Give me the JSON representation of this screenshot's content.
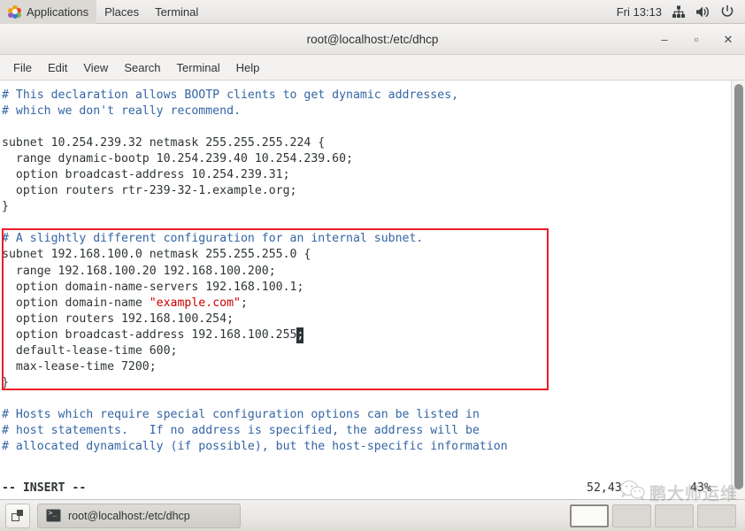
{
  "topbar": {
    "apps_label": "Applications",
    "places_label": "Places",
    "terminal_label": "Terminal",
    "clock": "Fri 13:13",
    "icons": {
      "applications": "pinwheel-icon",
      "network": "network-icon",
      "volume": "volume-icon",
      "power": "power-icon"
    }
  },
  "window": {
    "title": "root@localhost:/etc/dhcp",
    "buttons": {
      "minimize": "–",
      "maximize": "▫",
      "close": "✕"
    },
    "menu": [
      "File",
      "Edit",
      "View",
      "Search",
      "Terminal",
      "Help"
    ]
  },
  "terminal": {
    "lines": [
      {
        "segments": [
          {
            "text": "# This declaration allows BOOTP clients to get dynamic addresses,",
            "style": "comment"
          }
        ]
      },
      {
        "segments": [
          {
            "text": "# which we don't really recommend.",
            "style": "comment"
          }
        ]
      },
      {
        "segments": [
          {
            "text": "",
            "style": "plain"
          }
        ]
      },
      {
        "segments": [
          {
            "text": "subnet 10.254.239.32 netmask 255.255.255.224 {",
            "style": "plain"
          }
        ]
      },
      {
        "segments": [
          {
            "text": "  range dynamic-bootp 10.254.239.40 10.254.239.60;",
            "style": "plain"
          }
        ]
      },
      {
        "segments": [
          {
            "text": "  option broadcast-address 10.254.239.31;",
            "style": "plain"
          }
        ]
      },
      {
        "segments": [
          {
            "text": "  option routers rtr-239-32-1.example.org;",
            "style": "plain"
          }
        ]
      },
      {
        "segments": [
          {
            "text": "}",
            "style": "plain"
          }
        ]
      },
      {
        "segments": [
          {
            "text": "",
            "style": "plain"
          }
        ]
      },
      {
        "segments": [
          {
            "text": "# A slightly different configuration for an internal subnet.",
            "style": "comment"
          }
        ]
      },
      {
        "segments": [
          {
            "text": "subnet 192.168.100.0 netmask 255.255.255.0 {",
            "style": "plain"
          }
        ]
      },
      {
        "segments": [
          {
            "text": "  range 192.168.100.20 192.168.100.200;",
            "style": "plain"
          }
        ]
      },
      {
        "segments": [
          {
            "text": "  option domain-name-servers 192.168.100.1;",
            "style": "plain"
          }
        ]
      },
      {
        "segments": [
          {
            "text": "  option domain-name ",
            "style": "plain"
          },
          {
            "text": "\"example.com\"",
            "style": "string"
          },
          {
            "text": ";",
            "style": "plain"
          }
        ]
      },
      {
        "segments": [
          {
            "text": "  option routers 192.168.100.254;",
            "style": "plain"
          }
        ]
      },
      {
        "segments": [
          {
            "text": "  option broadcast-address 192.168.100.255",
            "style": "plain"
          },
          {
            "text": ";",
            "style": "cursor"
          }
        ]
      },
      {
        "segments": [
          {
            "text": "  default-lease-time 600;",
            "style": "plain"
          }
        ]
      },
      {
        "segments": [
          {
            "text": "  max-lease-time 7200;",
            "style": "plain"
          }
        ]
      },
      {
        "segments": [
          {
            "text": "}",
            "style": "plain"
          }
        ]
      },
      {
        "segments": [
          {
            "text": "",
            "style": "plain"
          }
        ]
      },
      {
        "segments": [
          {
            "text": "# Hosts which require special configuration options can be listed in",
            "style": "comment"
          }
        ]
      },
      {
        "segments": [
          {
            "text": "# host statements.   If no address is specified, the address will be",
            "style": "comment"
          }
        ]
      },
      {
        "segments": [
          {
            "text": "# allocated dynamically (if possible), but the host-specific information",
            "style": "comment"
          }
        ]
      }
    ],
    "status": {
      "mode": "-- INSERT --",
      "position": "52,43",
      "percent": "43%"
    },
    "annotation_color": "#ee1c25"
  },
  "watermark": {
    "text": "鹏大师运维",
    "icon": "wechat-icon"
  },
  "taskbar": {
    "show_desktop_icon": "show-desktop-icon",
    "tasks": [
      {
        "label": "root@localhost:/etc/dhcp",
        "icon": "terminal-icon"
      }
    ],
    "workspaces": [
      {
        "active": true
      },
      {
        "active": false
      },
      {
        "active": false
      },
      {
        "active": false
      }
    ]
  }
}
